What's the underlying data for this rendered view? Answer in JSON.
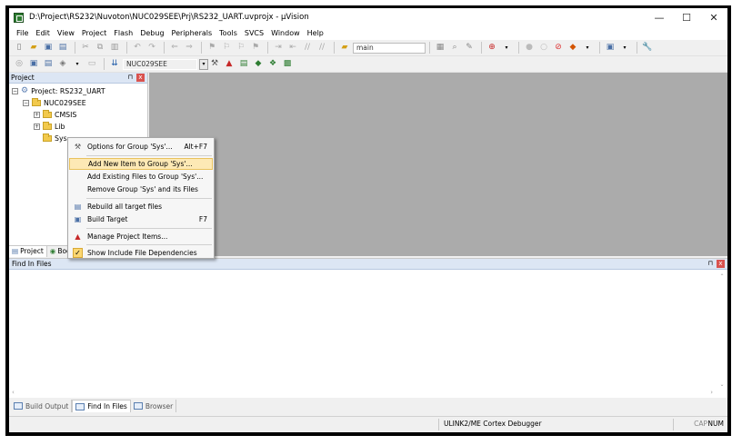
{
  "window": {
    "title": "D:\\Project\\RS232\\Nuvoton\\NUC029SEE\\Prj\\RS232_UART.uvprojx - µVision",
    "minimize": "—",
    "maximize": "☐",
    "close": "✕"
  },
  "menu": [
    "File",
    "Edit",
    "View",
    "Project",
    "Flash",
    "Debug",
    "Peripherals",
    "Tools",
    "SVCS",
    "Window",
    "Help"
  ],
  "toolbar": {
    "find_combo_value": "main",
    "target_combo_value": "NUC029SEE"
  },
  "project_pane": {
    "title": "Project",
    "pin": "⊓",
    "close": "x",
    "tree": {
      "root": "Project: RS232_UART",
      "target": "NUC029SEE",
      "groups": [
        "CMSIS",
        "Lib",
        "Sys"
      ]
    },
    "tabs": [
      "Project",
      "Boo"
    ]
  },
  "context_menu": {
    "items": [
      {
        "label": "Options for Group 'Sys'...",
        "shortcut": "Alt+F7"
      },
      {
        "label": "Add New  Item to Group 'Sys'...",
        "shortcut": ""
      },
      {
        "label": "Add Existing Files to Group 'Sys'...",
        "shortcut": ""
      },
      {
        "label": "Remove Group 'Sys' and its Files",
        "shortcut": ""
      },
      {
        "label": "Rebuild all target files",
        "shortcut": ""
      },
      {
        "label": "Build Target",
        "shortcut": "F7"
      },
      {
        "label": "Manage Project Items...",
        "shortcut": ""
      },
      {
        "label": "Show Include File Dependencies",
        "shortcut": ""
      }
    ]
  },
  "find_pane": {
    "title": "Find In Files",
    "pin": "⊓",
    "close": "x"
  },
  "bottom_tabs": [
    "Build Output",
    "Find In Files",
    "Browser"
  ],
  "status": {
    "debugger": "ULINK2/ME Cortex Debugger",
    "caps": "CAP",
    "num": "NUM"
  }
}
